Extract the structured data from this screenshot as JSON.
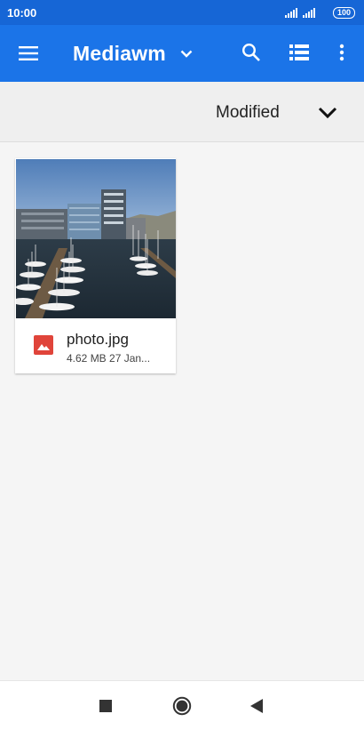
{
  "status_bar": {
    "time": "10:00",
    "battery": "100",
    "icons": [
      "signal-icon",
      "signal-icon",
      "battery-icon"
    ]
  },
  "app_bar": {
    "title": "Mediawm",
    "color": "#1b74e8",
    "icons": [
      "menu-icon",
      "chevron-down-icon",
      "search-icon",
      "list-view-icon",
      "more-vert-icon"
    ]
  },
  "sort_bar": {
    "label": "Modified",
    "icon": "chevron-down-icon"
  },
  "files": [
    {
      "name": "photo.jpg",
      "meta": "4.62 MB 27 Jan...",
      "icon": "image-file-icon",
      "icon_color": "#e0443a"
    }
  ],
  "nav_bar": {
    "icons": [
      "recents-square-icon",
      "home-circle-icon",
      "back-triangle-icon"
    ]
  }
}
